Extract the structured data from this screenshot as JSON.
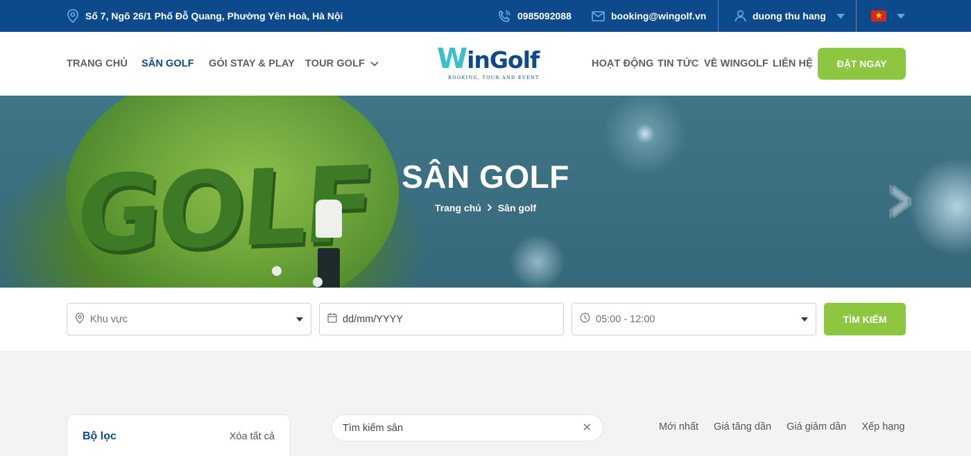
{
  "topbar": {
    "address": "Số 7, Ngõ 26/1 Phố Đỗ Quang, Phường Yên Hoà, Hà Nội",
    "phone": "0985092088",
    "email": "booking@wingolf.vn",
    "user": "duong thu hang"
  },
  "nav": {
    "left": [
      "TRANG CHỦ",
      "SÂN GOLF",
      "GÓI STAY & PLAY",
      "TOUR GOLF"
    ],
    "right": [
      "HOẠT ĐỘNG",
      "TIN TỨC",
      "VỀ WINGOLF",
      "LIÊN HỆ"
    ],
    "book": "ĐẶT NGAY",
    "logo_w": "W",
    "logo_rest": "inGolf",
    "logo_tag": "BOOKING, TOUR AND EVENT"
  },
  "hero": {
    "title": "SÂN GOLF",
    "crumb_home": "Trang chủ",
    "crumb_current": "Sân golf",
    "image_text": "GOLF"
  },
  "search": {
    "area": "Khu vực",
    "date": "dd/mm/YYYY",
    "time": "05:00 - 12:00",
    "button": "TÌM KIẾM"
  },
  "filter": {
    "title": "Bộ lọc",
    "clear": "Xóa tất cả"
  },
  "court_search": {
    "placeholder": "Tìm kiếm sân"
  },
  "sort": [
    "Mới nhất",
    "Giá tăng dần",
    "Giá giảm dần",
    "Xếp hạng"
  ],
  "colors": {
    "primary": "#0d4a8c",
    "accent": "#8dc63f",
    "teal": "#3dbfc9"
  },
  "icons": [
    "location-pin-icon",
    "phone-icon",
    "mail-icon",
    "user-icon",
    "caret-down-icon",
    "vietnam-flag-icon",
    "chevron-down-icon",
    "chevron-right-icon",
    "calendar-icon",
    "clock-icon",
    "close-icon"
  ]
}
